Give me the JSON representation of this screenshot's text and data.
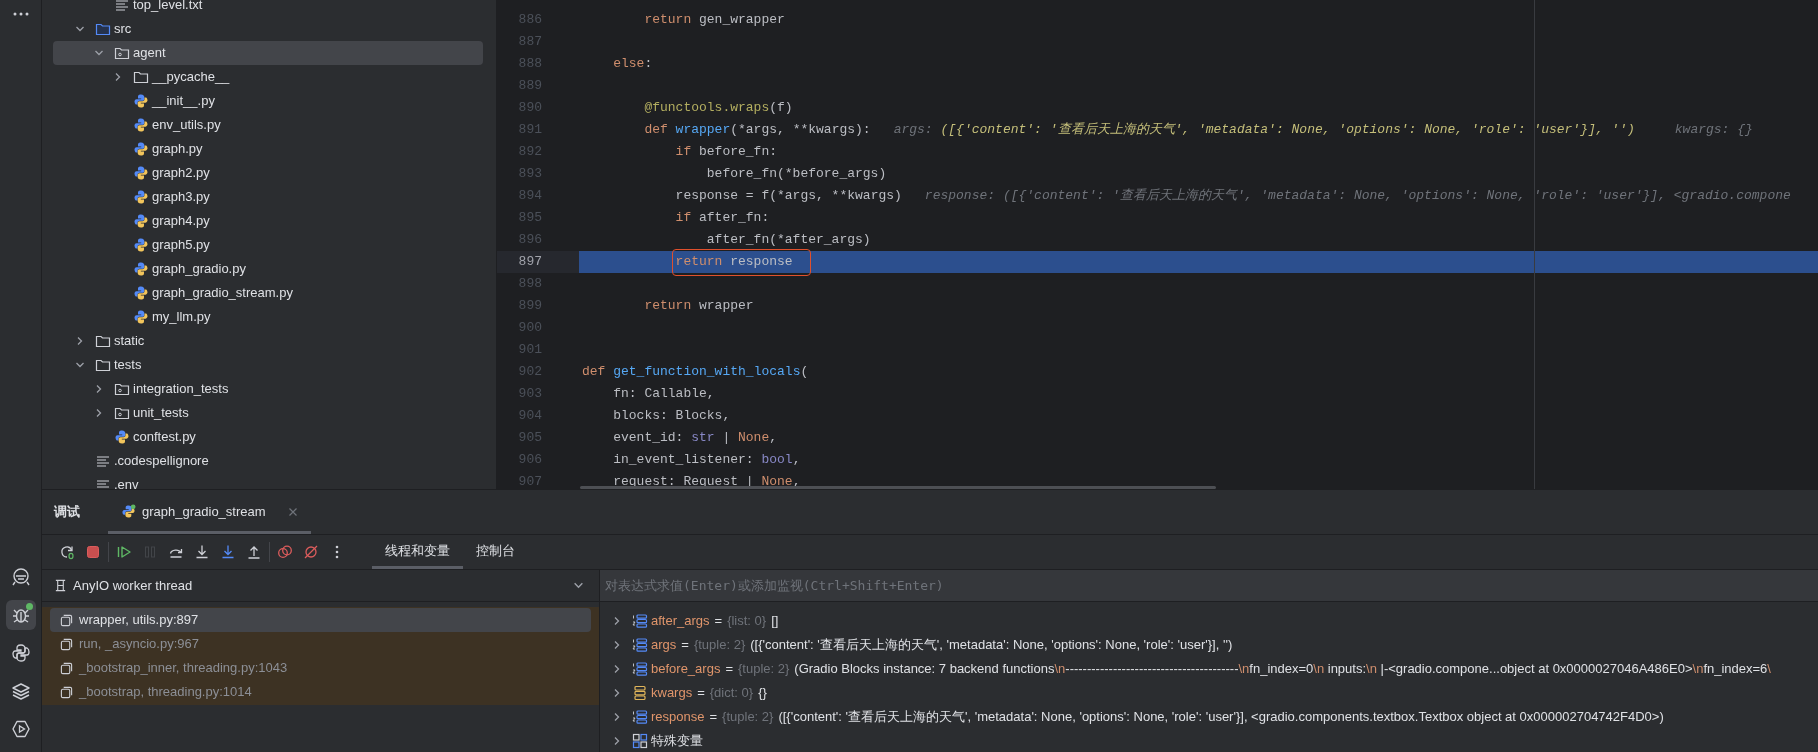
{
  "tool_strip": [
    {
      "kind": "assistant",
      "selected": false
    },
    {
      "kind": "debug",
      "selected": true
    },
    {
      "kind": "python",
      "selected": false
    },
    {
      "kind": "layers",
      "selected": false
    },
    {
      "kind": "run",
      "selected": false
    }
  ],
  "project_tree": {
    "cut_children": [
      {
        "kind": "text",
        "name": "top_level.txt",
        "selected": false
      }
    ],
    "items": [
      {
        "kind": "source-folder",
        "name": "src",
        "expanded": true,
        "selected": false,
        "children": [
          {
            "kind": "package",
            "name": "agent",
            "expanded": true,
            "selected": true,
            "children": [
              {
                "kind": "folder",
                "name": "__pycache__",
                "expanded": false,
                "selected": false
              },
              {
                "kind": "python",
                "name": "__init__.py",
                "selected": false
              },
              {
                "kind": "python",
                "name": "env_utils.py",
                "selected": false
              },
              {
                "kind": "python",
                "name": "graph.py",
                "selected": false
              },
              {
                "kind": "python",
                "name": "graph2.py",
                "selected": false
              },
              {
                "kind": "python",
                "name": "graph3.py",
                "selected": false
              },
              {
                "kind": "python",
                "name": "graph4.py",
                "selected": false
              },
              {
                "kind": "python",
                "name": "graph5.py",
                "selected": false
              },
              {
                "kind": "python",
                "name": "graph_gradio.py",
                "selected": false
              },
              {
                "kind": "python",
                "name": "graph_gradio_stream.py",
                "selected": false
              },
              {
                "kind": "python",
                "name": "my_llm.py",
                "selected": false
              }
            ]
          }
        ]
      },
      {
        "kind": "folder",
        "name": "static",
        "expanded": false,
        "selected": false
      },
      {
        "kind": "folder",
        "name": "tests",
        "expanded": true,
        "selected": false,
        "children": [
          {
            "kind": "package",
            "name": "integration_tests",
            "expanded": false,
            "selected": false
          },
          {
            "kind": "package",
            "name": "unit_tests",
            "expanded": false,
            "selected": false
          },
          {
            "kind": "python",
            "name": "conftest.py",
            "selected": false
          }
        ]
      },
      {
        "kind": "text",
        "name": ".codespellignore",
        "selected": false
      },
      {
        "kind": "text",
        "name": ".env",
        "selected": false
      }
    ]
  },
  "editor": {
    "lines": [
      {
        "number": "886",
        "current": false,
        "boxed": false,
        "tokens": [
          {
            "kind": "keyword",
            "text": "        return"
          },
          {
            "kind": "plain",
            "text": " gen_wrapper"
          }
        ]
      },
      {
        "number": "887",
        "current": false,
        "boxed": false
      },
      {
        "number": "888",
        "current": false,
        "boxed": false,
        "tokens": [
          {
            "kind": "keyword",
            "text": "    else"
          },
          {
            "kind": "plain",
            "text": ":"
          }
        ]
      },
      {
        "number": "889",
        "current": false,
        "boxed": false
      },
      {
        "number": "890",
        "current": false,
        "boxed": false,
        "tokens": [
          {
            "kind": "decorator",
            "text": "        @functools.wraps"
          },
          {
            "kind": "plain",
            "text": "(f)"
          }
        ]
      },
      {
        "number": "891",
        "current": false,
        "boxed": false,
        "tokens": [
          {
            "kind": "keyword",
            "text": "        def"
          },
          {
            "kind": "function",
            "text": " wrapper"
          },
          {
            "kind": "plain",
            "text": "(*args, **kwargs):"
          }
        ],
        "hints": [
          {
            "label": "args:",
            "value": "([{'content': '查看后天上海的天气', 'metadata': None, 'options': None, 'role': 'user'}], '')",
            "changed": true
          },
          {
            "label": "kwargs:",
            "value": "{}",
            "changed": false
          }
        ]
      },
      {
        "number": "892",
        "current": false,
        "boxed": false,
        "tokens": [
          {
            "kind": "keyword",
            "text": "            if"
          },
          {
            "kind": "plain",
            "text": " before_fn:"
          }
        ]
      },
      {
        "number": "893",
        "current": false,
        "boxed": false,
        "tokens": [
          {
            "kind": "plain",
            "text": "                before_fn(*before_args)"
          }
        ]
      },
      {
        "number": "894",
        "current": false,
        "boxed": false,
        "tokens": [
          {
            "kind": "plain",
            "text": "            response = f(*args, **kwargs)"
          }
        ],
        "hints": [
          {
            "label": "response:",
            "value": "([{'content': '查看后天上海的天气', 'metadata': None, 'options': None, 'role': 'user'}], <gradio.compone",
            "changed": false
          }
        ]
      },
      {
        "number": "895",
        "current": false,
        "boxed": false,
        "tokens": [
          {
            "kind": "keyword",
            "text": "            if"
          },
          {
            "kind": "plain",
            "text": " after_fn:"
          }
        ]
      },
      {
        "number": "896",
        "current": false,
        "boxed": false,
        "tokens": [
          {
            "kind": "plain",
            "text": "                after_fn(*after_args)"
          }
        ]
      },
      {
        "number": "897",
        "current": true,
        "boxed": true,
        "tokens": [
          {
            "kind": "keyword",
            "text": "            return"
          },
          {
            "kind": "plain",
            "text": " response"
          }
        ]
      },
      {
        "number": "898",
        "current": false,
        "boxed": false
      },
      {
        "number": "899",
        "current": false,
        "boxed": false,
        "tokens": [
          {
            "kind": "keyword",
            "text": "        return"
          },
          {
            "kind": "plain",
            "text": " wrapper"
          }
        ]
      },
      {
        "number": "900",
        "current": false,
        "boxed": false
      },
      {
        "number": "901",
        "current": false,
        "boxed": false
      },
      {
        "number": "902",
        "current": false,
        "boxed": false,
        "tokens": [
          {
            "kind": "keyword",
            "text": "def"
          },
          {
            "kind": "function",
            "text": " get_function_with_locals"
          },
          {
            "kind": "plain",
            "text": "("
          }
        ]
      },
      {
        "number": "903",
        "current": false,
        "boxed": false,
        "tokens": [
          {
            "kind": "plain",
            "text": "    fn: Callable,"
          }
        ]
      },
      {
        "number": "904",
        "current": false,
        "boxed": false,
        "tokens": [
          {
            "kind": "plain",
            "text": "    blocks: Blocks,"
          }
        ]
      },
      {
        "number": "905",
        "current": false,
        "boxed": false,
        "tokens": [
          {
            "kind": "plain",
            "text": "    event_id: "
          },
          {
            "kind": "type",
            "text": "str"
          },
          {
            "kind": "plain",
            "text": " | "
          },
          {
            "kind": "const",
            "text": "None"
          },
          {
            "kind": "plain",
            "text": ","
          }
        ]
      },
      {
        "number": "906",
        "current": false,
        "boxed": false,
        "tokens": [
          {
            "kind": "plain",
            "text": "    in_event_listener: "
          },
          {
            "kind": "type",
            "text": "bool"
          },
          {
            "kind": "plain",
            "text": ","
          }
        ]
      },
      {
        "number": "907",
        "current": false,
        "boxed": false,
        "tokens": [
          {
            "kind": "plain",
            "text": "    request: Request | "
          },
          {
            "kind": "const",
            "text": "None"
          },
          {
            "kind": "plain",
            "text": ","
          }
        ]
      }
    ]
  },
  "debug_panel": {
    "title": "调试",
    "sessions": [
      {
        "label": "graph_gradio_stream",
        "selected": true
      }
    ],
    "toolbar": [
      {
        "kind": "rerun",
        "disabled": false
      },
      {
        "kind": "stop",
        "disabled": false
      },
      {
        "kind": "separator"
      },
      {
        "kind": "resume",
        "disabled": false
      },
      {
        "kind": "pause",
        "disabled": true
      },
      {
        "kind": "step-over",
        "disabled": false
      },
      {
        "kind": "step-into",
        "disabled": false
      },
      {
        "kind": "step-into-my-code",
        "disabled": false
      },
      {
        "kind": "step-out",
        "disabled": false
      },
      {
        "kind": "separator"
      },
      {
        "kind": "breakpoints",
        "disabled": false
      },
      {
        "kind": "mute-breakpoints",
        "disabled": false
      },
      {
        "kind": "more",
        "disabled": false
      }
    ],
    "tabs": [
      {
        "label": "线程和变量",
        "selected": true
      },
      {
        "label": "控制台",
        "selected": false
      }
    ],
    "thread": {
      "label": "AnyIO worker thread"
    },
    "frames": [
      {
        "label": "wrapper, utils.py:897",
        "selected": true
      },
      {
        "label": "run, _asyncio.py:967",
        "selected": false
      },
      {
        "label": "_bootstrap_inner, threading.py:1043",
        "selected": false
      },
      {
        "label": "_bootstrap, threading.py:1014",
        "selected": false
      }
    ],
    "evaluate": {
      "placeholder": "对表达式求值(Enter)或添加监视(Ctrl+Shift+Enter)"
    },
    "variables": [
      {
        "kind": "list",
        "name": "after_args",
        "equals": "=",
        "type": "{list: 0}",
        "value": "[]"
      },
      {
        "kind": "list",
        "name": "args",
        "equals": "=",
        "type": "{tuple: 2}",
        "value": "([{'content': '查看后天上海的天气', 'metadata': None, 'options': None, 'role': 'user'}], '')"
      },
      {
        "kind": "list",
        "name": "before_args",
        "equals": "=",
        "type": "{tuple: 2}",
        "value": "(Gradio Blocks instance: 7 backend functions\\n----------------------------------------\\nfn_index=0\\n inputs:\\n |-<gradio.compone...object at 0x0000027046A486E0>\\nfn_index=6\\"
      },
      {
        "kind": "dict",
        "name": "kwargs",
        "equals": "=",
        "type": "{dict: 0}",
        "value": "{}"
      },
      {
        "kind": "list",
        "name": "response",
        "equals": "=",
        "type": "{tuple: 2}",
        "value": "([{'content': '查看后天上海的天气', 'metadata': None, 'options': None, 'role': 'user'}], <gradio.components.textbox.Textbox object at 0x000002704742F4D0>)"
      },
      {
        "kind": "special",
        "name": "特殊变量"
      }
    ]
  }
}
